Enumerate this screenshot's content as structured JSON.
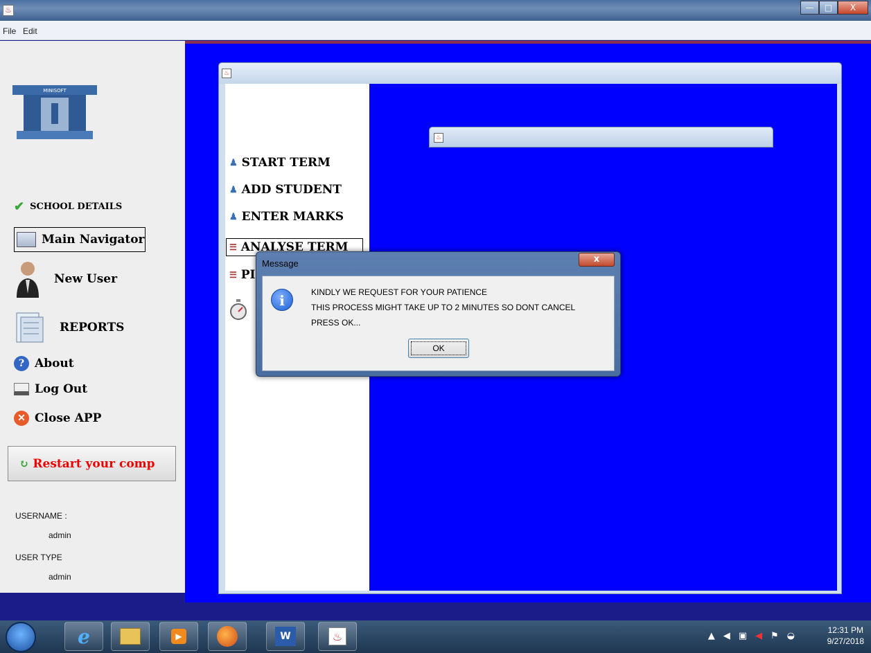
{
  "window": {
    "title": "",
    "min_label": "—",
    "max_label": "□",
    "close_label": "X"
  },
  "menu": {
    "items": [
      "File",
      "Edit"
    ]
  },
  "sidebar": {
    "logo_text": "MINISOFT",
    "school_details": "SCHOOL DETAILS",
    "main_navigator": "Main Navigator",
    "new_user": "New User",
    "reports": "REPORTS",
    "about": "About",
    "log_out": "Log Out",
    "close_app": "Close APP",
    "restart": "Restart your comp",
    "username_label": "USERNAME :",
    "username_value": "admin",
    "user_type_label": "USER TYPE",
    "user_type_value": "admin"
  },
  "inner_frame": {
    "nav": [
      "START TERM",
      "ADD STUDENT",
      "ENTER MARKS",
      "ANALYSE TERM",
      "PI"
    ]
  },
  "dialog": {
    "title": "Message",
    "close_label": "x",
    "line1": "KINDLY WE REQUEST FOR YOUR PATIENCE",
    "line2": "THIS PROCESS MIGHT TAKE UP TO 2 MINUTES SO DONT CANCEL",
    "line3": "PRESS OK...",
    "ok": "OK"
  },
  "taskbar": {
    "time": "12:31 PM",
    "date": "9/27/2018"
  },
  "colors": {
    "desktop": "#0000ff",
    "restart_text": "#ee0000"
  }
}
